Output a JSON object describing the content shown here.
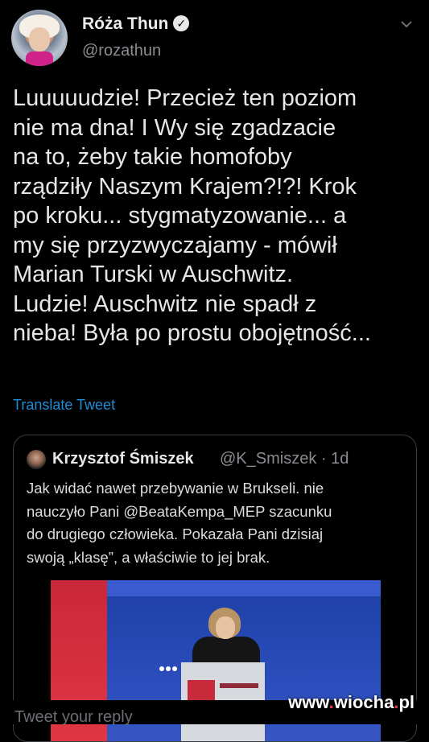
{
  "author": {
    "name": "Róża Thun",
    "handle": "@rozathun",
    "verified_icon": "verified-badge-icon"
  },
  "tweet": {
    "text": "Luuuuudzie! Przecież ten poziom\nnie ma dna! I Wy się zgadzacie\nna to, żeby takie homofoby\nrządziły Naszym Krajem?!?! Krok\npo kroku... stygmatyzowanie... a\nmy się przyzwyczajamy - mówił\nMarian Turski w Auschwitz.\nLudzie! Auschwitz nie spadł z\nnieba! Była po prostu obojętność...",
    "translate_label": "Translate Tweet"
  },
  "quoted": {
    "name": "Krzysztof Śmiszek",
    "handle_time": "@K_Smiszek · 1d",
    "text": "Jak widać nawet przebywanie w Brukseli. nie\nnauczyło Pani @BeataKempa_MEP szacunku\ndo drugiego człowieka. Pokazała Pani dzisiaj\nswoją „klasę”, a właściwie to jej brak."
  },
  "reply": {
    "placeholder": "Tweet your reply"
  },
  "watermark": {
    "prefix": "www",
    "dot1": ".",
    "middle": "wiocha",
    "dot2": ".",
    "suffix": "pl"
  },
  "colors": {
    "background": "#000000",
    "link": "#1d8fd8",
    "muted": "#8a8d91"
  }
}
